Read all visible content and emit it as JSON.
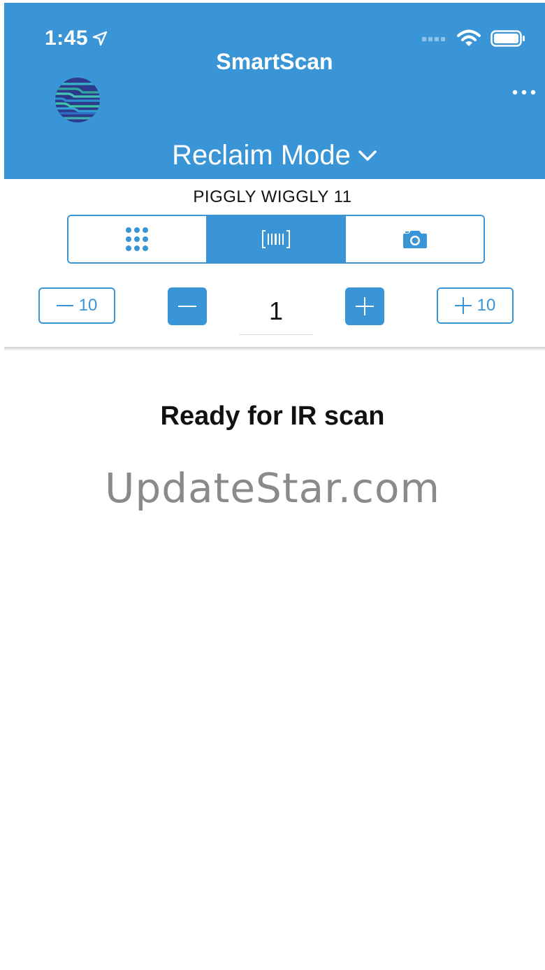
{
  "status_bar": {
    "time": "1:45"
  },
  "header": {
    "title": "SmartScan",
    "mode_label": "Reclaim Mode",
    "logo_icon": "globe-lines-logo-icon",
    "menu_icon": "ellipsis-icon"
  },
  "store": {
    "name": "PIGGLY WIGGLY 11"
  },
  "input_tabs": [
    {
      "icon": "keypad-icon",
      "active": false
    },
    {
      "icon": "barcode-icon",
      "active": true
    },
    {
      "icon": "camera-icon",
      "active": false
    }
  ],
  "quantity": {
    "minus_ten_label": "10",
    "plus_ten_label": "10",
    "value": "1"
  },
  "main": {
    "status_message": "Ready for IR scan",
    "watermark": "UpdateStar.com"
  },
  "colors": {
    "accent": "#3a95d7",
    "text": "#111111",
    "watermark": "#8a8a8a"
  }
}
